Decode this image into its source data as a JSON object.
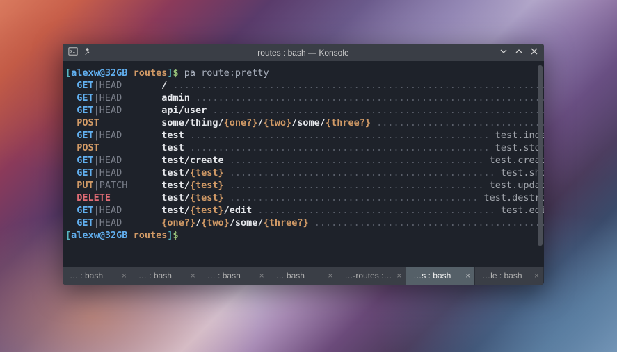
{
  "window": {
    "title": "routes : bash — Konsole"
  },
  "prompt": {
    "user_host": "alexw@32GB",
    "cwd": "routes",
    "symbol": "$",
    "command": "pa route:pretty"
  },
  "routes": [
    {
      "method": "GET",
      "verbs": "GET|HEAD",
      "uri_plain": "/",
      "params": [],
      "name": ""
    },
    {
      "method": "GET",
      "verbs": "GET|HEAD",
      "uri_plain": "admin",
      "params": [],
      "name": ""
    },
    {
      "method": "GET",
      "verbs": "GET|HEAD",
      "uri_plain": "api/user",
      "params": [],
      "name": ""
    },
    {
      "method": "POST",
      "verbs": "POST",
      "uri_plain": "some/thing/",
      "uri_tail": "/some/",
      "params": [
        "{one?}",
        "{two}",
        "{three?}"
      ],
      "name": ""
    },
    {
      "method": "GET",
      "verbs": "GET|HEAD",
      "uri_plain": "test",
      "params": [],
      "name": "test.index"
    },
    {
      "method": "POST",
      "verbs": "POST",
      "uri_plain": "test",
      "params": [],
      "name": "test.store"
    },
    {
      "method": "GET",
      "verbs": "GET|HEAD",
      "uri_plain": "test/create",
      "params": [],
      "name": "test.create"
    },
    {
      "method": "GET",
      "verbs": "GET|HEAD",
      "uri_plain": "test/",
      "params": [
        "{test}"
      ],
      "name": "test.show"
    },
    {
      "method": "PUT",
      "verbs": "PUT|PATCH",
      "uri_plain": "test/",
      "params": [
        "{test}"
      ],
      "name": "test.update"
    },
    {
      "method": "DELETE",
      "verbs": "DELETE",
      "uri_plain": "test/",
      "params": [
        "{test}"
      ],
      "name": "test.destroy"
    },
    {
      "method": "GET",
      "verbs": "GET|HEAD",
      "uri_plain": "test/",
      "uri_tail": "/edit",
      "params": [
        "{test}"
      ],
      "name": "test.edit"
    },
    {
      "method": "GET",
      "verbs": "GET|HEAD",
      "uri_plain": "",
      "uri_tail": "/some/",
      "params": [
        "{one?}",
        "{two}",
        "{three?}"
      ],
      "name": ""
    }
  ],
  "tabs": [
    {
      "label": "… : bash",
      "active": false
    },
    {
      "label": "… : bash",
      "active": false
    },
    {
      "label": "… : bash",
      "active": false
    },
    {
      "label": "… bash",
      "active": false
    },
    {
      "label": "…-routes : bash",
      "active": false
    },
    {
      "label": "…s : bash",
      "active": true
    },
    {
      "label": "…le : bash",
      "active": false
    }
  ],
  "layout": {
    "method_col": 15,
    "uri_col_start": 17,
    "total_cols": 86
  }
}
